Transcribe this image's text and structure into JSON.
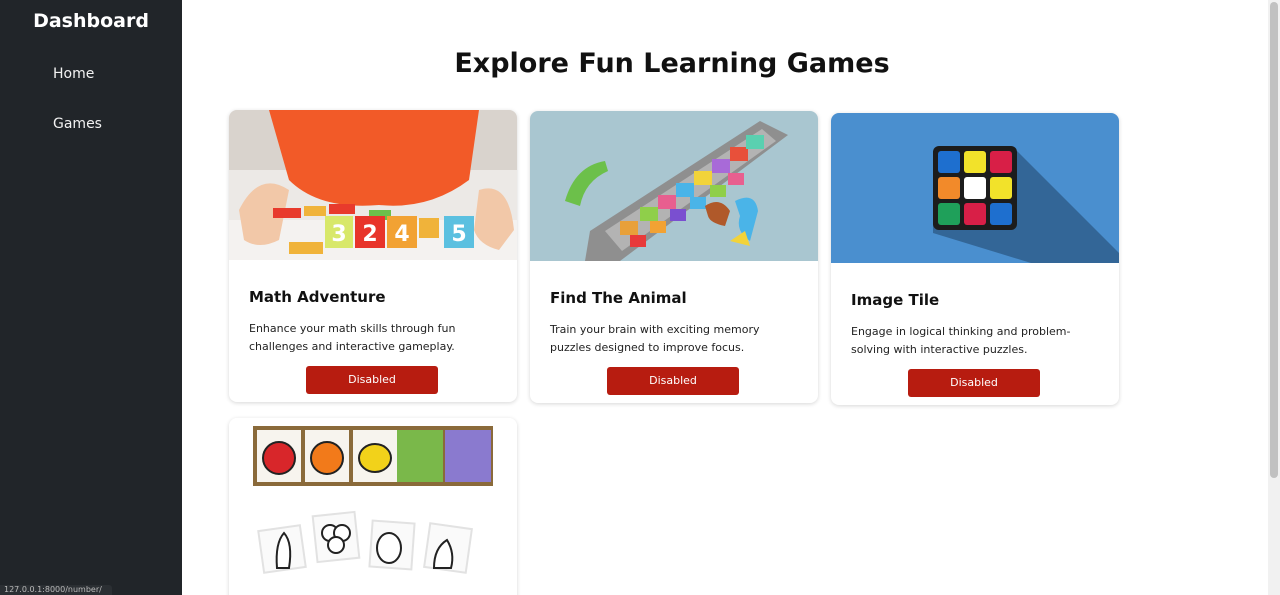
{
  "sidebar": {
    "brand": "Dashboard",
    "items": [
      {
        "label": "Home"
      },
      {
        "label": "Games"
      }
    ]
  },
  "status_url": "127.0.0.1:8000/number/",
  "main": {
    "title": "Explore Fun Learning Games",
    "cards": [
      {
        "title": "Math Adventure",
        "description": "Enhance your math skills through fun challenges and interactive gameplay.",
        "button": "Disabled",
        "image_blocks": [
          "3",
          "2",
          "4",
          "5"
        ]
      },
      {
        "title": "Find The Animal",
        "description": "Train your brain with exciting memory puzzles designed to improve focus.",
        "button": "Disabled"
      },
      {
        "title": "Image Tile",
        "description": "Engage in logical thinking and problem-solving with interactive puzzles.",
        "button": "Disabled"
      },
      {
        "title": "",
        "description": "",
        "button": ""
      }
    ]
  },
  "colors": {
    "sidebar_bg": "#212529",
    "button_bg": "#b71c10",
    "tile_bg": "#4a8fcf"
  }
}
